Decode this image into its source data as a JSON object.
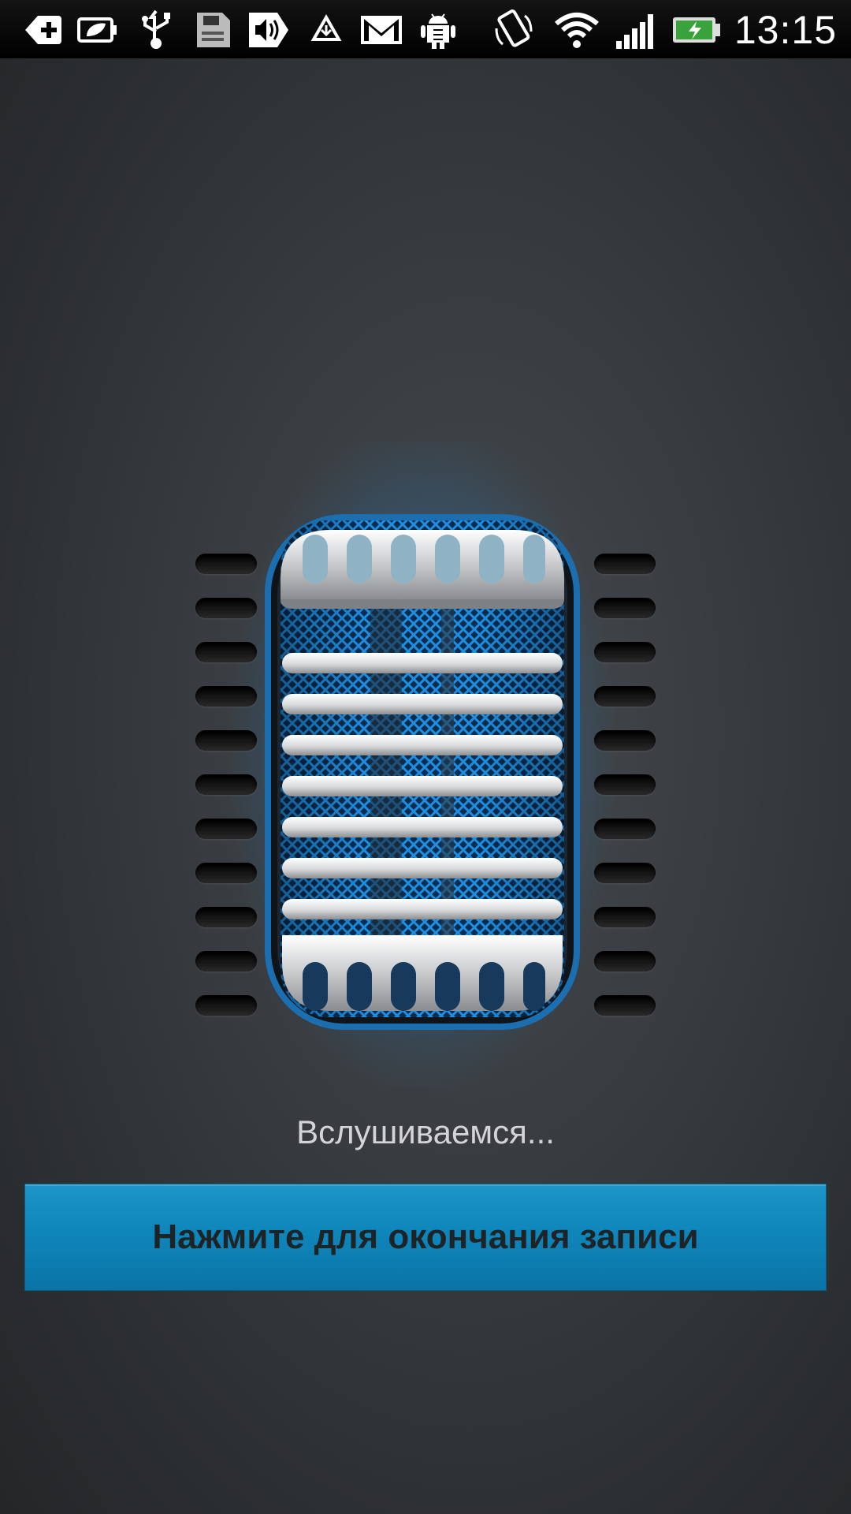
{
  "status_bar": {
    "icons": [
      "add-shortcut-icon",
      "battery-saver-icon",
      "usb-icon",
      "sd-card-icon",
      "volume-icon",
      "alert-triangle-icon",
      "gmail-icon",
      "android-debug-icon",
      "auto-rotate-icon",
      "wifi-icon",
      "signal-icon",
      "battery-charging-icon"
    ],
    "time": "13:15"
  },
  "recorder": {
    "status": "Вслушиваемся...",
    "stop_label": "Нажмите для окончания записи"
  },
  "colors": {
    "accent": "#0f86bb",
    "glow": "#2aa7ff",
    "background": "#3a3e42"
  }
}
